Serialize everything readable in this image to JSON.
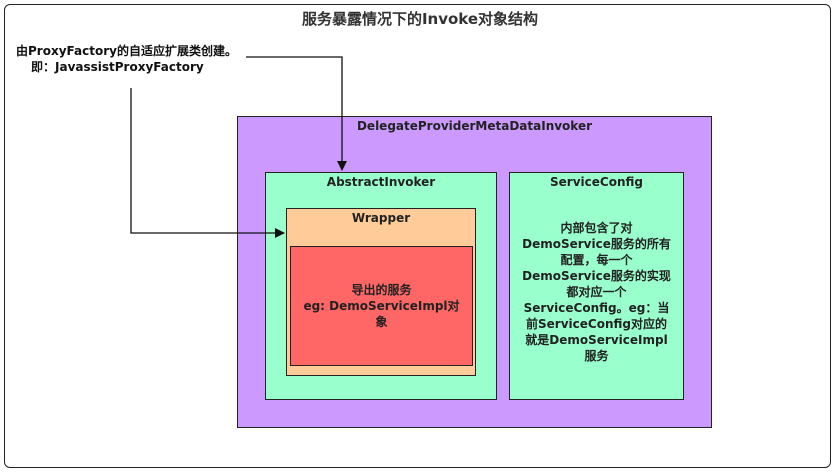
{
  "title": "服务暴露情况下的Invoke对象结构",
  "note": {
    "line1": "由ProxyFactory的自适应扩展类创建。",
    "line2": "即：JavassistProxyFactory"
  },
  "boxes": {
    "outer": {
      "label": "DelegateProviderMetaDataInvoker",
      "color": "#cc99ff"
    },
    "abstract_invoker": {
      "label": "AbstractInvoker",
      "color": "#99ffcc"
    },
    "wrapper": {
      "label": "Wrapper",
      "color": "#ffcc99"
    },
    "exported_service": {
      "lines": [
        "导出的服务",
        "eg: DemoServiceImpl对",
        "象"
      ],
      "color": "#ff6666"
    },
    "service_config": {
      "label": "ServiceConfig",
      "lines": [
        "内部包含了对",
        "DemoService服务的所有",
        "配置，每一个",
        "DemoService服务的实现",
        "都对应一个",
        "ServiceConfig。eg：当",
        "前ServiceConfig对应的",
        "就是DemoServiceImpl",
        "服务"
      ],
      "color": "#99ffcc"
    }
  }
}
